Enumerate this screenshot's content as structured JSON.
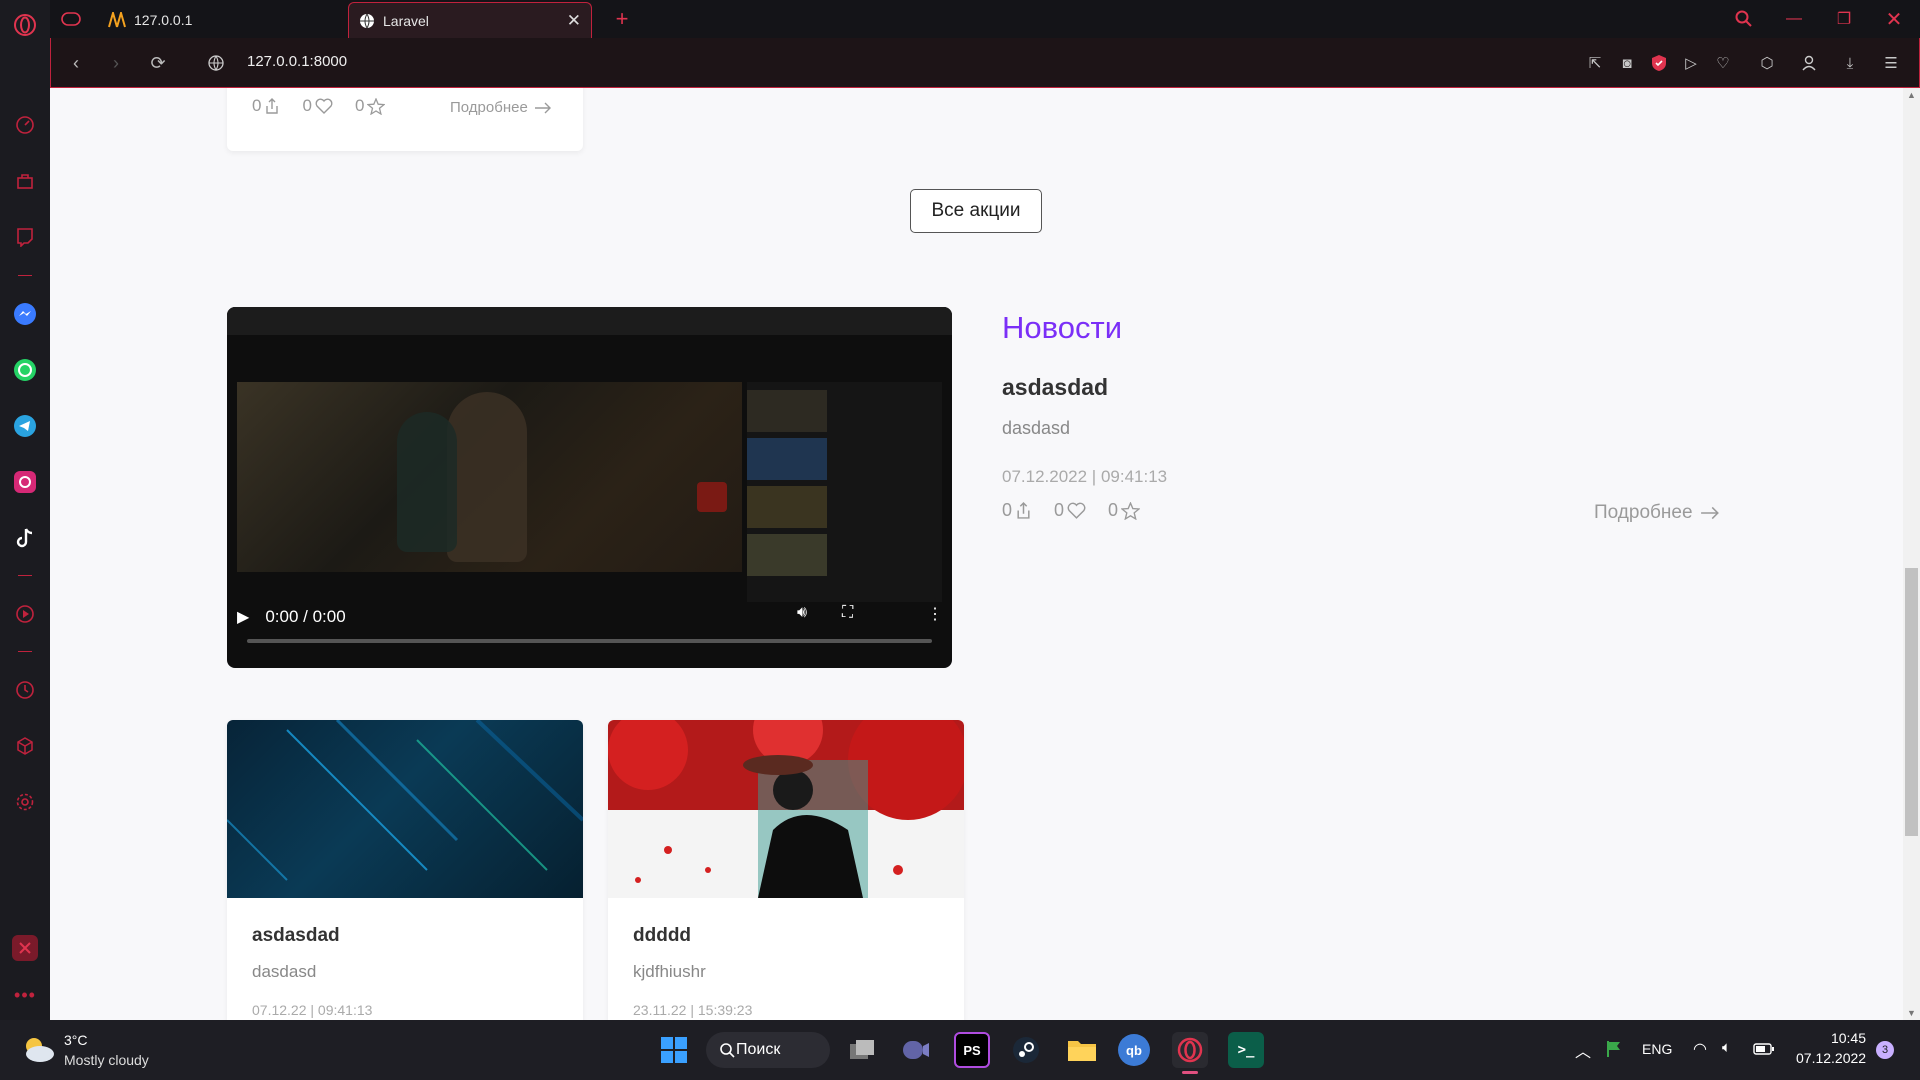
{
  "browser": {
    "tabs": [
      {
        "label": "127.0.0.1"
      },
      {
        "label": "Laravel"
      }
    ],
    "url": "127.0.0.1:8000"
  },
  "top_card": {
    "shares": "0",
    "likes": "0",
    "stars": "0",
    "more_label": "Подробнее"
  },
  "all_promos_button": "Все акции",
  "news": {
    "heading": "Новости",
    "title": "asdasdad",
    "description": "dasdasd",
    "date": "07.12.2022 | 09:41:13",
    "shares": "0",
    "likes": "0",
    "stars": "0",
    "more_label": "Подробнее",
    "video_time": "0:00 / 0:00"
  },
  "cards": [
    {
      "title": "asdasdad",
      "description": "dasdasd",
      "date": "07.12.22 | 09:41:13"
    },
    {
      "title": "ddddd",
      "description": "kjdfhiushr",
      "date": "23.11.22 | 15:39:23"
    }
  ],
  "taskbar": {
    "weather_temp": "3°C",
    "weather_desc": "Mostly cloudy",
    "search_label": "Поиск",
    "lang": "ENG",
    "time": "10:45",
    "date": "07.12.2022",
    "notif_count": "3"
  },
  "colors": {
    "accent": "#c0223d",
    "news_heading": "#7b2ff7"
  }
}
